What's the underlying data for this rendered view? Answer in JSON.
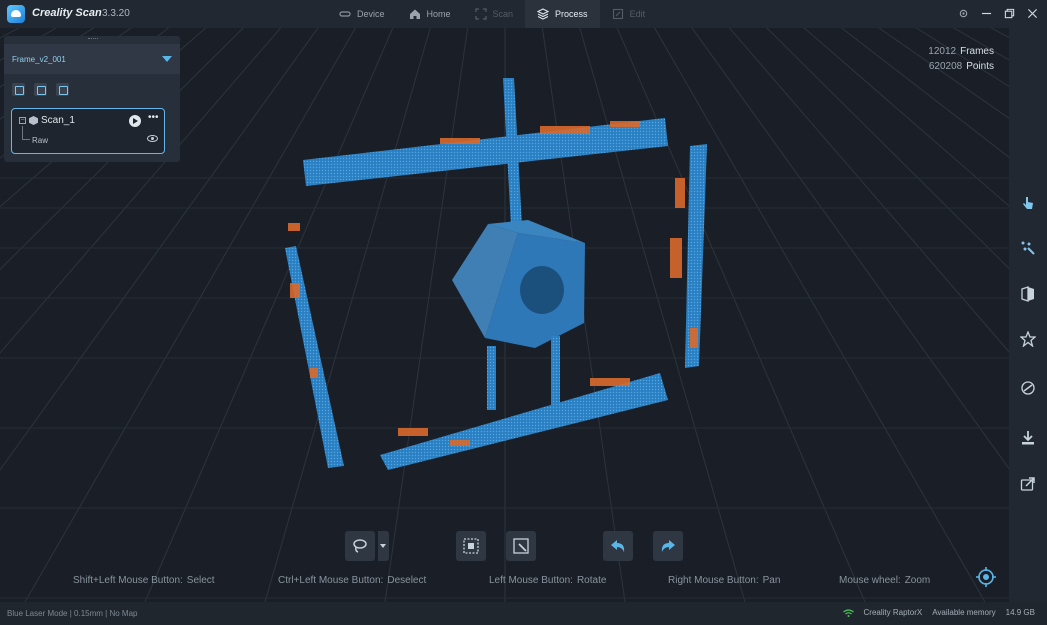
{
  "app": {
    "name": "Creality Scan",
    "version": "3.3.20"
  },
  "nav": {
    "tabs": [
      {
        "label": "Device",
        "icon": "device-icon",
        "state": "normal"
      },
      {
        "label": "Home",
        "icon": "home-icon",
        "state": "normal"
      },
      {
        "label": "Scan",
        "icon": "scan-icon",
        "state": "disabled"
      },
      {
        "label": "Process",
        "icon": "layers-icon",
        "state": "active"
      },
      {
        "label": "Edit",
        "icon": "edit-icon",
        "state": "disabled"
      }
    ]
  },
  "project": {
    "frame_name": "Frame_v2_001",
    "scan_name": "Scan_1",
    "child_label": "Raw"
  },
  "stats": {
    "frames_value": "12012",
    "frames_label": "Frames",
    "points_value": "620208",
    "points_label": "Points"
  },
  "hints": {
    "select_key": "Shift+Left Mouse Button:",
    "select_val": "Select",
    "deselect_key": "Ctrl+Left Mouse Button:",
    "deselect_val": "Deselect",
    "rotate_key": "Left Mouse Button:",
    "rotate_val": "Rotate",
    "pan_key": "Right Mouse Button:",
    "pan_val": "Pan",
    "zoom_key": "Mouse wheel:",
    "zoom_val": "Zoom"
  },
  "status": {
    "mode": "Blue Laser Mode",
    "resolution": "0.15mm",
    "map": "No Map",
    "device": "Creality RaptorX",
    "memory_label": "Available memory",
    "memory_value": "14.9 GB"
  },
  "colors": {
    "accent": "#5ab5e8",
    "cloud_blue": "#2f86c9",
    "cloud_orange": "#d9692c"
  }
}
